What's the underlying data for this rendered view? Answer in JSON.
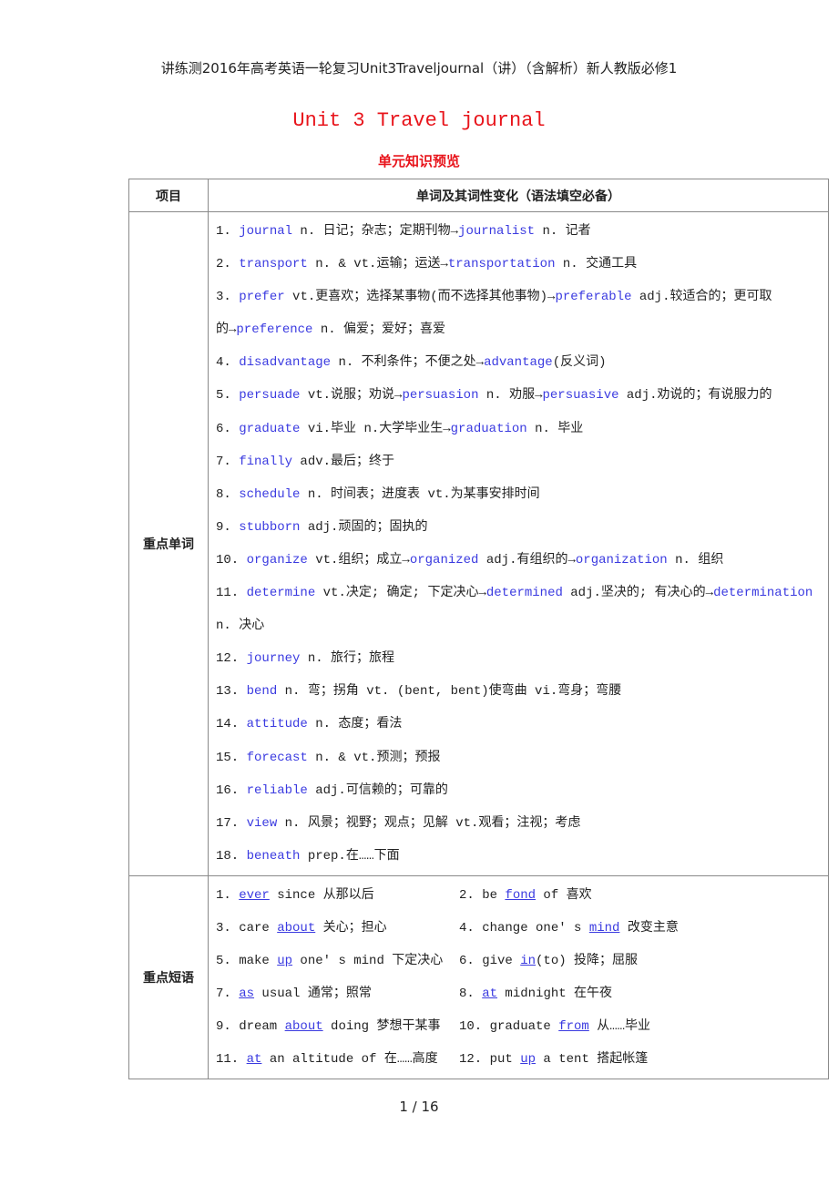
{
  "page_header": "讲练测2016年高考英语一轮复习Unit3Traveljournal（讲）（含解析）新人教版必修1",
  "title": "Unit 3 Travel journal",
  "subtitle": "单元知识预览",
  "table": {
    "headers": [
      "项目",
      "单词及其词性变化（语法填空必备）"
    ],
    "vocab_label": "重点单词",
    "phrase_label": "重点短语",
    "vocab_lines": [
      [
        {
          "t": "1. "
        },
        {
          "k": "journal"
        },
        {
          "t": " n. 日记；杂志；定期刊物→"
        },
        {
          "k": "journalist"
        },
        {
          "t": " n. 记者"
        }
      ],
      [
        {
          "t": "2. "
        },
        {
          "k": "transport"
        },
        {
          "t": " n. & vt.运输；运送→"
        },
        {
          "k": "transportation"
        },
        {
          "t": " n. 交通工具"
        }
      ],
      [
        {
          "t": "3. "
        },
        {
          "k": "prefer"
        },
        {
          "t": " vt.更喜欢；选择某事物(而不选择其他事物)→"
        },
        {
          "k": "preferable"
        },
        {
          "t": " adj.较适合的；更可取"
        }
      ],
      [
        {
          "t": "的→"
        },
        {
          "k": "preference"
        },
        {
          "t": " n. 偏爱；爱好；喜爱"
        }
      ],
      [
        {
          "t": "4. "
        },
        {
          "k": "disadvantage"
        },
        {
          "t": " n. 不利条件；不便之处→"
        },
        {
          "k": "advantage"
        },
        {
          "t": "(反义词)"
        }
      ],
      [
        {
          "t": "5. "
        },
        {
          "k": "persuade"
        },
        {
          "t": " vt.说服；劝说→"
        },
        {
          "k": "persuasion"
        },
        {
          "t": " n. 劝服→"
        },
        {
          "k": "persuasive"
        },
        {
          "t": " adj.劝说的；有说服力的"
        }
      ],
      [
        {
          "t": "6. "
        },
        {
          "k": "graduate"
        },
        {
          "t": " vi.毕业 n.大学毕业生→"
        },
        {
          "k": "graduation"
        },
        {
          "t": " n. 毕业"
        }
      ],
      [
        {
          "t": "7. "
        },
        {
          "k": "finally"
        },
        {
          "t": " adv.最后；终于"
        }
      ],
      [
        {
          "t": "8. "
        },
        {
          "k": "schedule"
        },
        {
          "t": " n. 时间表；进度表 vt.为某事安排时间"
        }
      ],
      [
        {
          "t": "9. "
        },
        {
          "k": "stubborn"
        },
        {
          "t": " adj.顽固的；固执的"
        }
      ],
      [
        {
          "t": "10. "
        },
        {
          "k": "organize"
        },
        {
          "t": " vt.组织；成立→"
        },
        {
          "k": "organized"
        },
        {
          "t": " adj.有组织的→"
        },
        {
          "k": "organization"
        },
        {
          "t": " n. 组织"
        }
      ],
      [
        {
          "t": "11. "
        },
        {
          "k": "determine"
        },
        {
          "t": " vt.决定; 确定; 下定决心→"
        },
        {
          "k": "determined"
        },
        {
          "t": " adj.坚决的; 有决心的→"
        },
        {
          "k": "determination"
        }
      ],
      [
        {
          "t": "n. 决心"
        }
      ],
      [
        {
          "t": "12. "
        },
        {
          "k": "journey"
        },
        {
          "t": " n. 旅行；旅程"
        }
      ],
      [
        {
          "t": "13. "
        },
        {
          "k": "bend"
        },
        {
          "t": " n. 弯；拐角 vt. (bent, bent)使弯曲 vi.弯身；弯腰"
        }
      ],
      [
        {
          "t": "14. "
        },
        {
          "k": "attitude"
        },
        {
          "t": " n. 态度；看法"
        }
      ],
      [
        {
          "t": "15. "
        },
        {
          "k": "forecast"
        },
        {
          "t": " n. & vt.预测；预报"
        }
      ],
      [
        {
          "t": "16. "
        },
        {
          "k": "reliable"
        },
        {
          "t": " adj.可信赖的；可靠的"
        }
      ],
      [
        {
          "t": "17. "
        },
        {
          "k": "view"
        },
        {
          "t": " n. 风景；视野；观点；见解 vt.观看；注视；考虑"
        }
      ],
      [
        {
          "t": "18. "
        },
        {
          "k": "beneath"
        },
        {
          "t": " prep.在……下面"
        }
      ]
    ],
    "phrase_lines": [
      [
        [
          {
            "t": "1. "
          },
          {
            "p": "ever"
          },
          {
            "t": " since 从那以后"
          }
        ],
        [
          {
            "t": "2. be "
          },
          {
            "p": "fond"
          },
          {
            "t": " of  喜欢"
          }
        ]
      ],
      [
        [
          {
            "t": "3. care "
          },
          {
            "p": "about"
          },
          {
            "t": "  关心；担心"
          }
        ],
        [
          {
            "t": "4. change one' s "
          },
          {
            "p": "mind"
          },
          {
            "t": "  改变主意"
          }
        ]
      ],
      [
        [
          {
            "t": "5. make "
          },
          {
            "p": "up"
          },
          {
            "t": " one' s mind  下定决心"
          }
        ],
        [
          {
            "t": "6. give "
          },
          {
            "p": "in"
          },
          {
            "t": "(to)  投降；屈服"
          }
        ]
      ],
      [
        [
          {
            "t": "7. "
          },
          {
            "p": "as"
          },
          {
            "t": " usual  通常；照常"
          }
        ],
        [
          {
            "t": "8. "
          },
          {
            "p": "at"
          },
          {
            "t": " midnight  在午夜"
          }
        ]
      ],
      [
        [
          {
            "t": "9. dream "
          },
          {
            "p": "about"
          },
          {
            "t": " doing  梦想干某事"
          }
        ],
        [
          {
            "t": "10. graduate "
          },
          {
            "p": "from"
          },
          {
            "t": "  从……毕业"
          }
        ]
      ],
      [
        [
          {
            "t": "11. "
          },
          {
            "p": "at"
          },
          {
            "t": " an altitude of  在……高度"
          }
        ],
        [
          {
            "t": "12. put "
          },
          {
            "p": "up"
          },
          {
            "t": " a tent  搭起帐篷"
          }
        ]
      ]
    ]
  },
  "page_number": "1 / 16"
}
